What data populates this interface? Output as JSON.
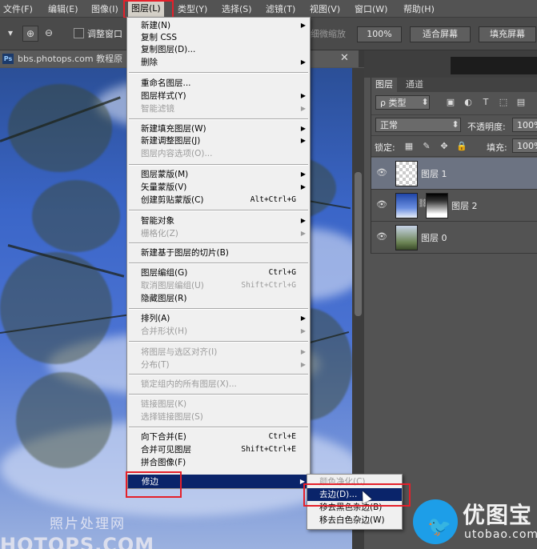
{
  "menubar": {
    "items": [
      {
        "label": "文件(F)"
      },
      {
        "label": "编辑(E)"
      },
      {
        "label": "图像(I)"
      },
      {
        "label": "图层(L)"
      },
      {
        "label": "类型(Y)"
      },
      {
        "label": "选择(S)"
      },
      {
        "label": "滤镜(T)"
      },
      {
        "label": "视图(V)"
      },
      {
        "label": "窗口(W)"
      },
      {
        "label": "帮助(H)"
      }
    ]
  },
  "options_bar": {
    "resize_windows_label": "调整窗口",
    "scrubby_zoom_label": "细微缩放",
    "percent_button": "100%",
    "fit_screen_button": "适合屏幕",
    "fill_screen_button": "填充屏幕"
  },
  "document": {
    "ps_badge": "Ps",
    "tab_label": "bbs.photops.com 教程原",
    "watermark_cn": "照片处理网",
    "watermark_en": "HOTOPS.COM"
  },
  "layers_panel": {
    "tabs": [
      {
        "label": "图层"
      },
      {
        "label": "通道"
      }
    ],
    "filter_kind": "ρ 类型",
    "blend_mode": "正常",
    "opacity_label": "不透明度:",
    "opacity_value": "100%",
    "lock_label": "锁定:",
    "fill_label": "填充:",
    "fill_value": "100%",
    "layers": [
      {
        "name": "图层 1"
      },
      {
        "name": "图层 2"
      },
      {
        "name": "图层 0"
      }
    ]
  },
  "layer_menu": {
    "items": [
      {
        "label": "新建(N)",
        "shortcut": "",
        "arrow": "▶"
      },
      {
        "label": "复制 CSS",
        "shortcut": "",
        "arrow": ""
      },
      {
        "label": "复制图层(D)...",
        "shortcut": "",
        "arrow": ""
      },
      {
        "label": "删除",
        "shortcut": "",
        "arrow": "▶"
      },
      {
        "label": "重命名图层...",
        "shortcut": "",
        "arrow": ""
      },
      {
        "label": "图层样式(Y)",
        "shortcut": "",
        "arrow": "▶"
      },
      {
        "label": "智能滤镜",
        "shortcut": "",
        "arrow": "▶"
      },
      {
        "label": "新建填充图层(W)",
        "shortcut": "",
        "arrow": "▶"
      },
      {
        "label": "新建调整图层(J)",
        "shortcut": "",
        "arrow": "▶"
      },
      {
        "label": "图层内容选项(O)...",
        "shortcut": "",
        "arrow": ""
      },
      {
        "label": "图层蒙版(M)",
        "shortcut": "",
        "arrow": "▶"
      },
      {
        "label": "矢量蒙版(V)",
        "shortcut": "",
        "arrow": "▶"
      },
      {
        "label": "创建剪贴蒙版(C)",
        "shortcut": "Alt+Ctrl+G",
        "arrow": ""
      },
      {
        "label": "智能对象",
        "shortcut": "",
        "arrow": "▶"
      },
      {
        "label": "栅格化(Z)",
        "shortcut": "",
        "arrow": "▶"
      },
      {
        "label": "新建基于图层的切片(B)",
        "shortcut": "",
        "arrow": ""
      },
      {
        "label": "图层编组(G)",
        "shortcut": "Ctrl+G",
        "arrow": ""
      },
      {
        "label": "取消图层编组(U)",
        "shortcut": "Shift+Ctrl+G",
        "arrow": ""
      },
      {
        "label": "隐藏图层(R)",
        "shortcut": "",
        "arrow": ""
      },
      {
        "label": "排列(A)",
        "shortcut": "",
        "arrow": "▶"
      },
      {
        "label": "合并形状(H)",
        "shortcut": "",
        "arrow": "▶"
      },
      {
        "label": "将图层与选区对齐(I)",
        "shortcut": "",
        "arrow": "▶"
      },
      {
        "label": "分布(T)",
        "shortcut": "",
        "arrow": "▶"
      },
      {
        "label": "锁定组内的所有图层(X)...",
        "shortcut": "",
        "arrow": ""
      },
      {
        "label": "链接图层(K)",
        "shortcut": "",
        "arrow": ""
      },
      {
        "label": "选择链接图层(S)",
        "shortcut": "",
        "arrow": ""
      },
      {
        "label": "向下合并(E)",
        "shortcut": "Ctrl+E",
        "arrow": ""
      },
      {
        "label": "合并可见图层",
        "shortcut": "Shift+Ctrl+E",
        "arrow": ""
      },
      {
        "label": "拼合图像(F)",
        "shortcut": "",
        "arrow": ""
      },
      {
        "label": "修边",
        "shortcut": "",
        "arrow": "▶"
      }
    ]
  },
  "matting_submenu": {
    "items": [
      {
        "label": "颜色净化(C)"
      },
      {
        "label": "去边(D)..."
      },
      {
        "label": "移去黑色杂边(B)"
      },
      {
        "label": "移去白色杂边(W)"
      }
    ]
  },
  "logo": {
    "title": "优图宝",
    "url": "utobao.com",
    "bird_glyph": "🐦"
  }
}
